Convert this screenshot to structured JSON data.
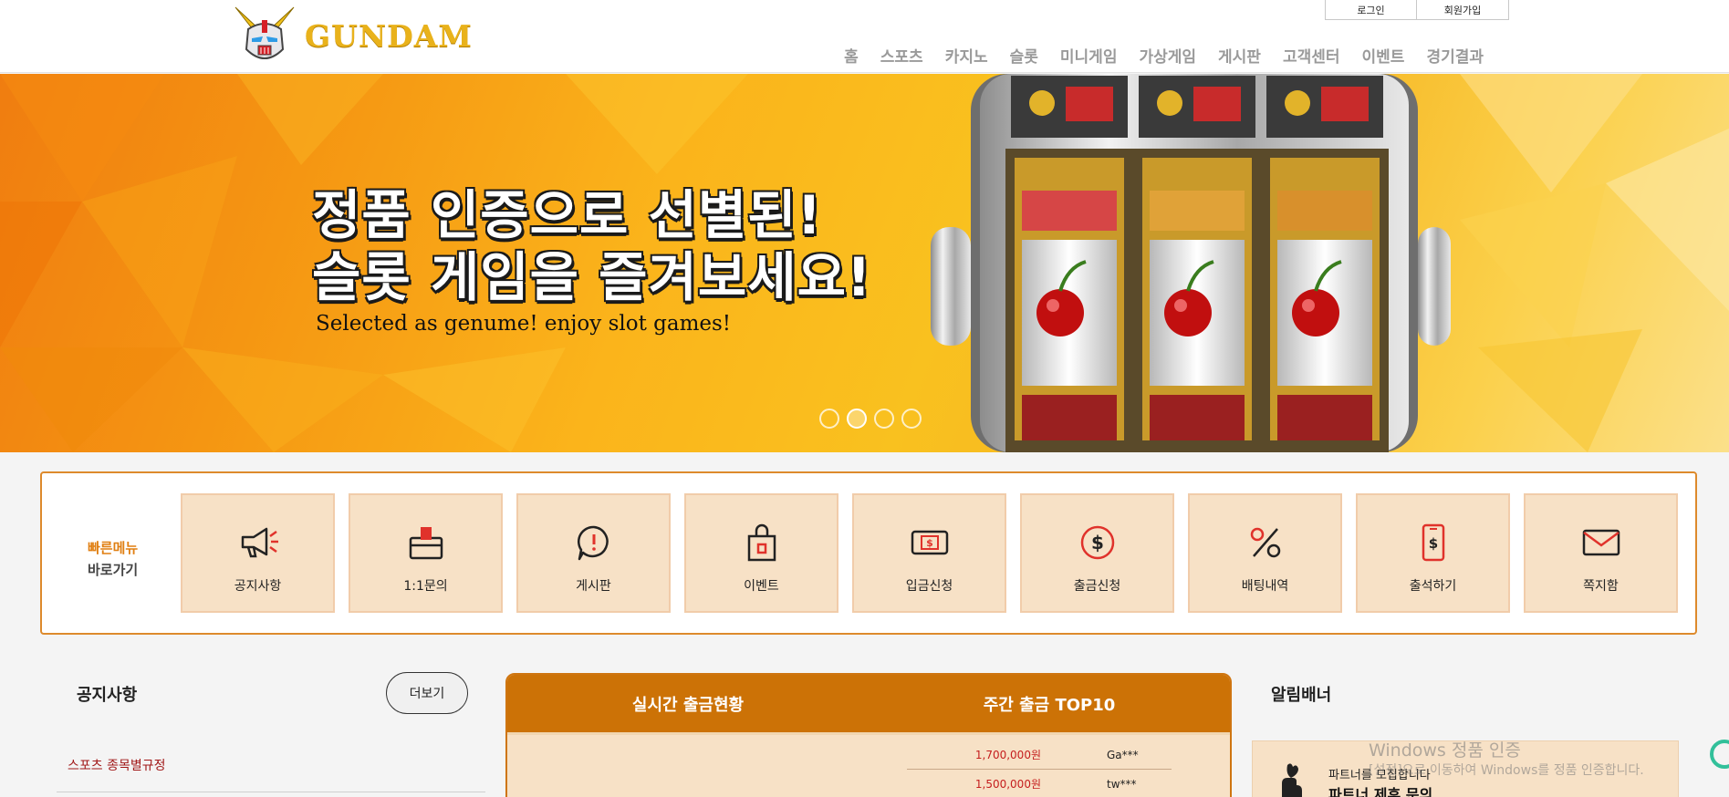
{
  "header": {
    "logo_text": "GUNDAM",
    "auth": {
      "login": "로그인",
      "signup": "회원가입"
    },
    "nav": [
      "홈",
      "스포츠",
      "카지노",
      "슬롯",
      "미니게임",
      "가상게임",
      "게시판",
      "고객센터",
      "이벤트",
      "경기결과"
    ]
  },
  "banner": {
    "headline_1": "정품 인증으로 선별된!",
    "headline_2": "슬롯 게임을 즐겨보세요!",
    "subtitle": "Selected as genume! enjoy slot games!",
    "slide_count": 4,
    "active_slide": 2
  },
  "quick_menu": {
    "title_1": "빠른메뉴",
    "title_2": "바로가기",
    "items": [
      {
        "label": "공지사항",
        "icon": "megaphone-icon"
      },
      {
        "label": "1:1문의",
        "icon": "inbox-icon"
      },
      {
        "label": "게시판",
        "icon": "chat-bubble-icon"
      },
      {
        "label": "이벤트",
        "icon": "gift-bag-icon"
      },
      {
        "label": "입금신청",
        "icon": "cash-deposit-icon"
      },
      {
        "label": "출금신청",
        "icon": "coin-dollar-icon"
      },
      {
        "label": "배팅내역",
        "icon": "percent-icon"
      },
      {
        "label": "출석하기",
        "icon": "phone-dollar-icon"
      },
      {
        "label": "쪽지함",
        "icon": "envelope-icon"
      }
    ]
  },
  "notice": {
    "title": "공지사항",
    "more": "더보기",
    "items": [
      "스포츠 종목별규정"
    ]
  },
  "withdraw": {
    "tab_live": "실시간 출금현황",
    "tab_top10": "주간 출금 TOP10",
    "rows": [
      {
        "amount": "1,700,000원",
        "name": "Ga***"
      },
      {
        "amount": "1,500,000원",
        "name": "tw***"
      }
    ]
  },
  "alarm": {
    "title": "알림배너",
    "partner_small": "파트너를 모집합니다",
    "partner_big": "파트너 제휴 문의"
  },
  "watermark": {
    "line1": "Windows 정품 인증",
    "line2": "[설정]으로 이동하여 Windows를 정품 인증합니다."
  },
  "colors": {
    "accent": "#cc7206",
    "accent_border": "#dd8a2c",
    "tile_bg": "#f7e1c6",
    "icon_red": "#e0322b",
    "amount_red": "#c51e1e"
  }
}
